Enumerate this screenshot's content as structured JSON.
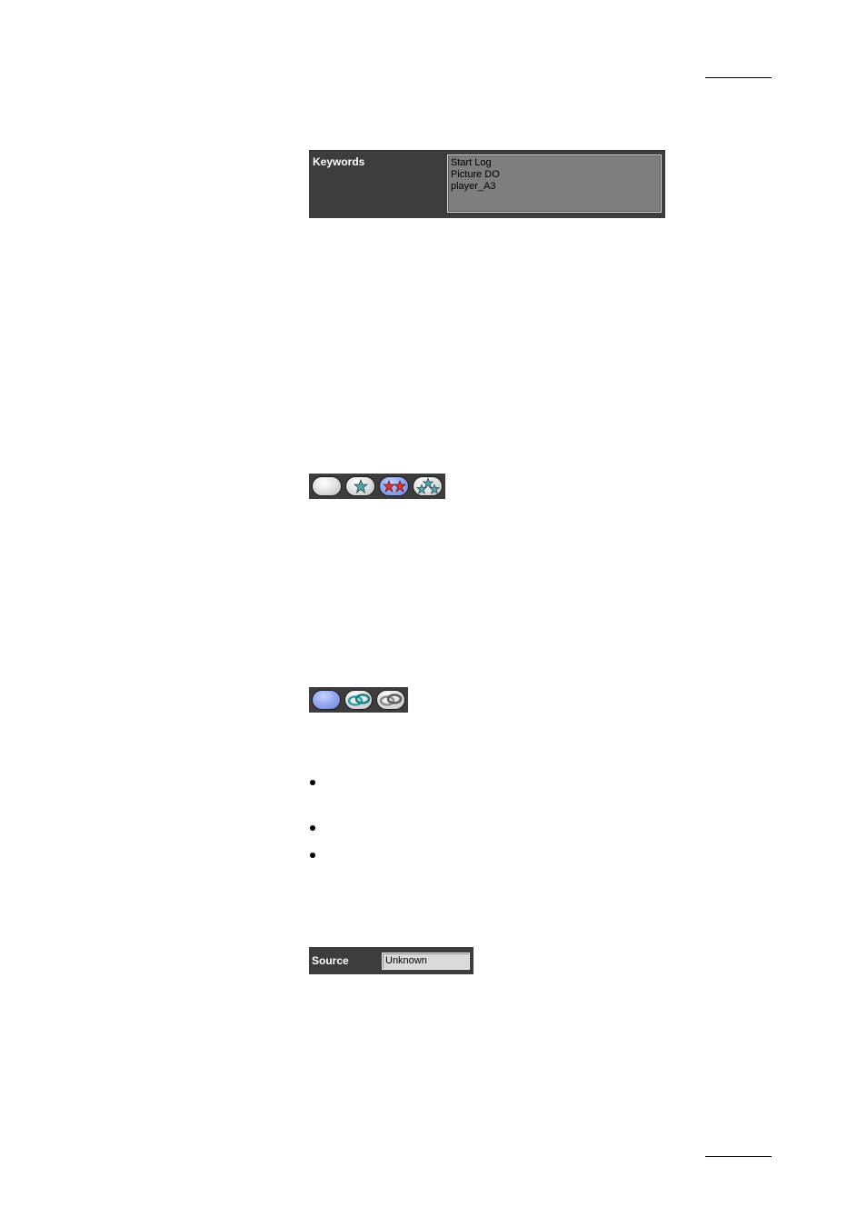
{
  "keywords": {
    "label": "Keywords",
    "items": [
      "Start Log",
      "Picture DO",
      "player_A3"
    ]
  },
  "rating_buttons": [
    {
      "icon": "blank-pill-icon"
    },
    {
      "icon": "one-star-icon"
    },
    {
      "icon": "two-stars-icon",
      "selected": true
    },
    {
      "icon": "three-stars-icon"
    }
  ],
  "link_buttons": [
    {
      "icon": "blank-pill-icon",
      "selected": true
    },
    {
      "icon": "link-icon"
    },
    {
      "icon": "link-grey-icon"
    }
  ],
  "bullets": [
    "",
    "",
    ""
  ],
  "source": {
    "label": "Source",
    "value": "Unknown"
  },
  "colors": {
    "panel": "#3d3d3d",
    "field": "#7f7f7f",
    "selected_pill": "#96aaf0",
    "star_red": "#d9343a",
    "link_teal": "#2aa3a8"
  }
}
